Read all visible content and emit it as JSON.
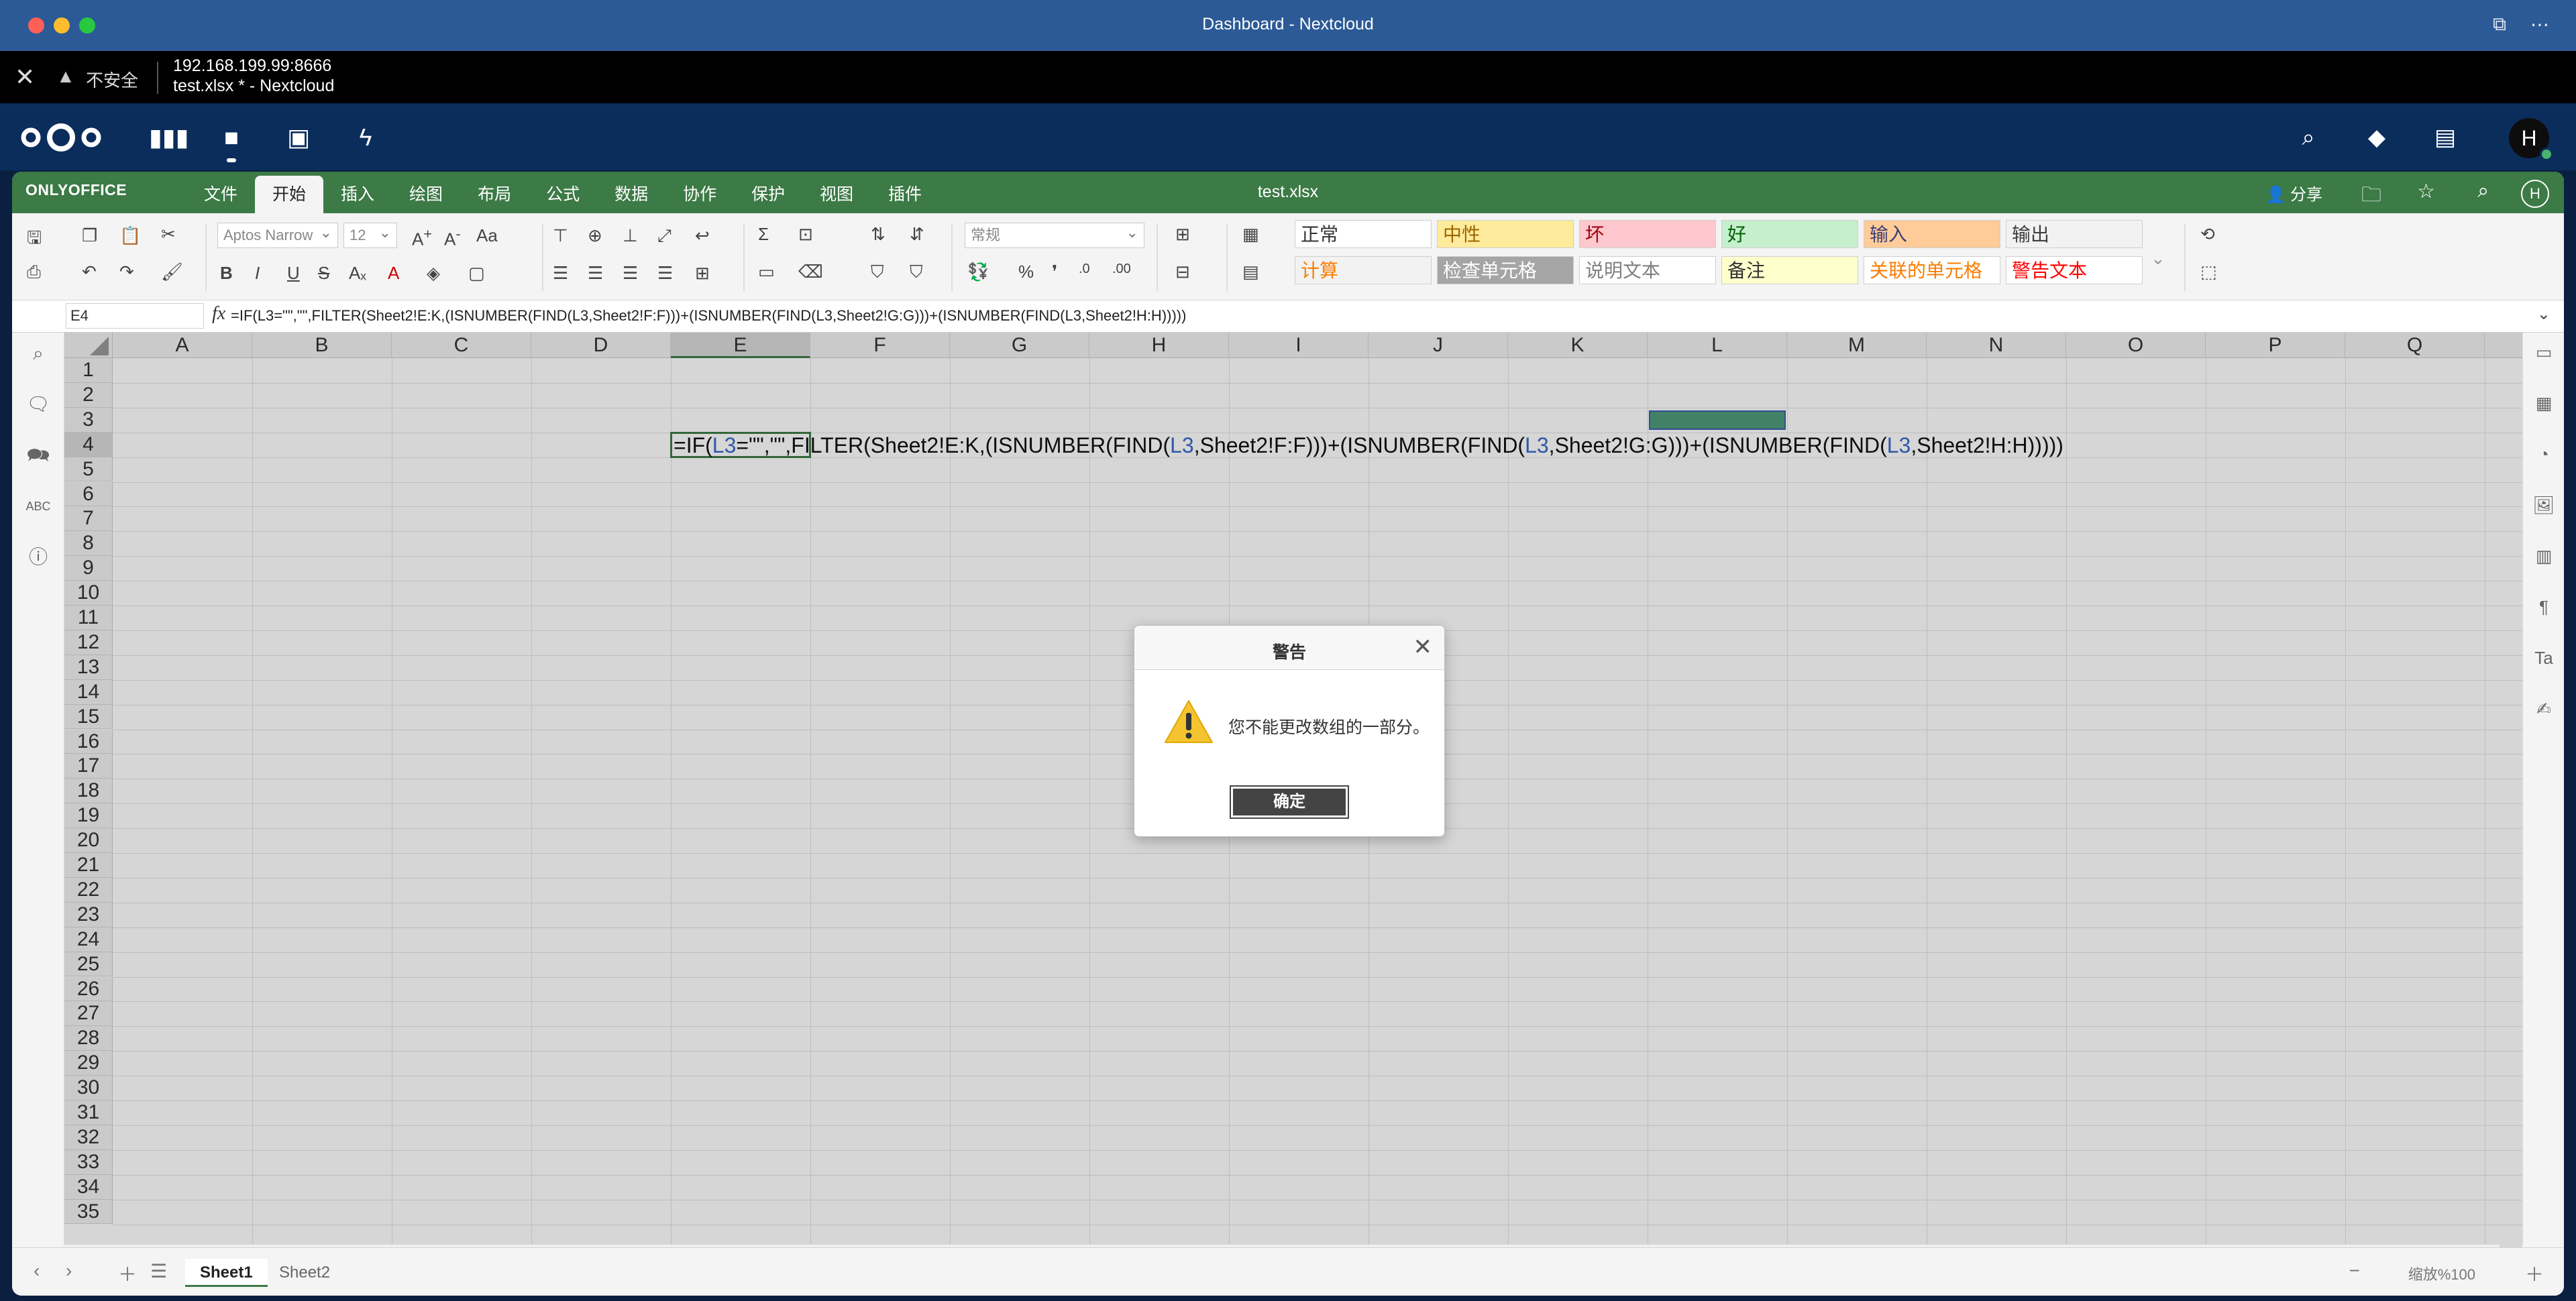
{
  "window": {
    "title": "Dashboard - Nextcloud",
    "accent": "#2c5a96"
  },
  "browser": {
    "insecure_label": "不安全",
    "url": "192.168.199.99:8666",
    "page_title": "test.xlsx * - Nextcloud"
  },
  "nextcloud": {
    "avatar_letter": "H",
    "header_color": "#0b2d5b"
  },
  "onlyoffice": {
    "brand": "ONLYOFFICE",
    "menu": [
      "文件",
      "开始",
      "插入",
      "绘图",
      "布局",
      "公式",
      "数据",
      "协作",
      "保护",
      "视图",
      "插件"
    ],
    "active_menu": "开始",
    "file_name": "test.xlsx",
    "share_label": "分享",
    "user_letter": "H",
    "brand_color": "#3c7a46"
  },
  "ribbon": {
    "font_name": "Aptos Narrow",
    "font_size": "12",
    "number_format": "常规",
    "cell_styles": [
      {
        "label": "正常",
        "color": "#333333",
        "bg": "#ffffff"
      },
      {
        "label": "中性",
        "color": "#9c6500",
        "bg": "#ffeb9c"
      },
      {
        "label": "坏",
        "color": "#9c0006",
        "bg": "#ffc7ce"
      },
      {
        "label": "好",
        "color": "#006100",
        "bg": "#c6efce"
      },
      {
        "label": "输入",
        "color": "#3f3f76",
        "bg": "#ffcc99"
      },
      {
        "label": "输出",
        "color": "#3f3f3f",
        "bg": "#f2f2f2"
      },
      {
        "label": "计算",
        "color": "#fa7d00",
        "bg": "#f2f2f2"
      },
      {
        "label": "检查单元格",
        "color": "#ffffff",
        "bg": "#a5a5a5"
      },
      {
        "label": "说明文本",
        "color": "#7f7f7f",
        "bg": "#ffffff"
      },
      {
        "label": "备注",
        "color": "#333333",
        "bg": "#ffffcc"
      },
      {
        "label": "关联的单元格",
        "color": "#fa7d00",
        "bg": "#ffffff"
      },
      {
        "label": "警告文本",
        "color": "#ff0000",
        "bg": "#ffffff"
      }
    ]
  },
  "formula_bar": {
    "cell_ref": "E4",
    "fx_label": "fx",
    "formula": "=IF(L3=\"\",\"\",FILTER(Sheet2!E:K,(ISNUMBER(FIND(L3,Sheet2!F:F)))+(ISNUMBER(FIND(L3,Sheet2!G:G)))+(ISNUMBER(FIND(L3,Sheet2!H:H)))))"
  },
  "sheet": {
    "columns": [
      "A",
      "B",
      "C",
      "D",
      "E",
      "F",
      "G",
      "H",
      "I",
      "J",
      "K",
      "L",
      "M",
      "N",
      "O",
      "P",
      "Q"
    ],
    "selected_column": "E",
    "rows": [
      "1",
      "2",
      "3",
      "4",
      "5",
      "6",
      "7",
      "8",
      "9",
      "10",
      "11",
      "12",
      "13",
      "14",
      "15",
      "16",
      "17",
      "18",
      "19",
      "20",
      "21",
      "22",
      "23",
      "24",
      "25",
      "26",
      "27",
      "28",
      "29",
      "30",
      "31",
      "32",
      "33",
      "34",
      "35"
    ],
    "selected_row": "4",
    "cell_text_parts": [
      {
        "text": "=IF(",
        "ref": false
      },
      {
        "text": "L3",
        "ref": true
      },
      {
        "text": "=\"\",\"\",FILTER(Sheet2!E:K,(ISNUMBER(FIND(",
        "ref": false
      },
      {
        "text": "L3",
        "ref": true
      },
      {
        "text": ",Sheet2!F:F)))+(ISNUMBER(FIND(",
        "ref": false
      },
      {
        "text": "L3",
        "ref": true
      },
      {
        "text": ",Sheet2!G:G)))+(ISNUMBER(FIND(",
        "ref": false
      },
      {
        "text": "L3",
        "ref": true
      },
      {
        "text": ",Sheet2!H:H)))))",
        "ref": false
      }
    ],
    "tabs": [
      "Sheet1",
      "Sheet2"
    ],
    "active_tab": "Sheet1",
    "zoom_label": "缩放%100"
  },
  "dialog": {
    "title": "警告",
    "message": "您不能更改数组的一部分。",
    "ok_label": "确定"
  }
}
